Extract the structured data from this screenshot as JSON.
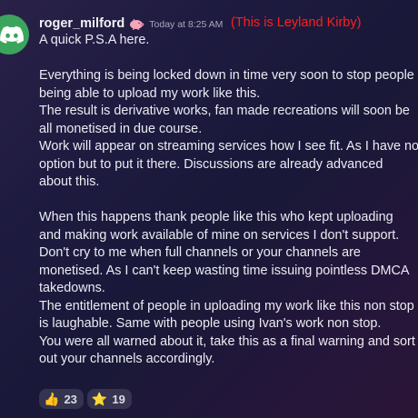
{
  "message": {
    "username": "roger_milford",
    "badge_icon": "pig-icon",
    "timestamp": "Today at 8:25 AM",
    "annotation": "(This is Leyland Kirby)",
    "annotation_color": "#ff1f1f",
    "avatar_color": "#3ba55d",
    "lines": [
      "A quick P.S.A here.",
      "",
      "Everything is being locked down in time very soon to stop people",
      "being able to upload my work like this.",
      "The result is derivative works, fan made recreations will soon be",
      "all monetised in due course.",
      "Work will appear on streaming services how I see fit. As I have no",
      "option but to put it there. Discussions are already advanced",
      "about this.",
      "",
      "When this happens thank people like this who kept uploading",
      "and making work available of mine on services I don't support.",
      "Don't cry to me when full channels or your channels are",
      "monetised.  As I can't keep wasting time issuing pointless DMCA",
      "takedowns.",
      "The entitlement of people in uploading my work like this non stop",
      "is laughable. Same with people using Ivan's work non stop.",
      "You were all warned about it, take this as a final warning and sort",
      "out your channels accordingly."
    ]
  },
  "reactions": [
    {
      "emoji": "👍",
      "icon": "thumbs-up-icon",
      "count": "23"
    },
    {
      "emoji": "⭐",
      "icon": "star-icon",
      "count": "19"
    }
  ]
}
